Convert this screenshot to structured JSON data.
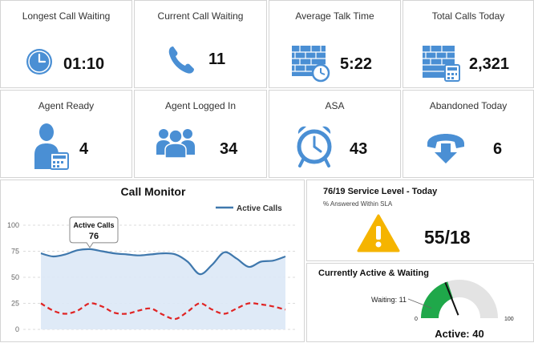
{
  "colors": {
    "accent_blue": "#4a8fd4",
    "warning_yellow": "#f5b400",
    "danger_red": "#e02424",
    "gauge_green": "#1fa84a",
    "line_blue": "#3f78ad"
  },
  "tiles": [
    {
      "title": "Longest Call Waiting",
      "value": "01:10",
      "icon": "clock-icon"
    },
    {
      "title": "Current Call Waiting",
      "value": "11",
      "icon": "phone-icon"
    },
    {
      "title": "Average Talk Time",
      "value": "5:22",
      "icon": "brick-wall-clock-icon"
    },
    {
      "title": "Total Calls Today",
      "value": "2,321",
      "icon": "building-phone-icon"
    },
    {
      "title": "Agent Ready",
      "value": "4",
      "icon": "agent-icon"
    },
    {
      "title": "Agent Logged In",
      "value": "34",
      "icon": "group-icon"
    },
    {
      "title": "ASA",
      "value": "43",
      "icon": "alarm-clock-icon"
    },
    {
      "title": "Abandoned Today",
      "value": "6",
      "icon": "hangup-phone-icon"
    }
  ],
  "call_monitor": {
    "title": "Call Monitor",
    "legend": "Active Calls",
    "tooltip_label": "Active Calls",
    "tooltip_value": "76"
  },
  "service_level": {
    "title": "76/19 Service Level - Today",
    "subtitle": "% Answered Within SLA",
    "value": "55/18",
    "icon": "warning-icon"
  },
  "active_waiting": {
    "title": "Currently Active & Waiting",
    "waiting_label": "Waiting: 11",
    "active_label": "Active: 40",
    "gauge_min": "0",
    "gauge_max": "100",
    "active": 40,
    "waiting": 11
  },
  "chart_data": {
    "type": "line",
    "title": "Call Monitor",
    "xlabel": "",
    "ylabel": "",
    "ylim": [
      0,
      100
    ],
    "yticks": [
      "100",
      "75",
      "50",
      "25",
      "0"
    ],
    "x": [
      0,
      1,
      2,
      3,
      4,
      5,
      6,
      7,
      8,
      9,
      10,
      11,
      12,
      13,
      14,
      15,
      16,
      17,
      18,
      19,
      20
    ],
    "series": [
      {
        "name": "Active Calls",
        "values": [
          73,
          70,
          72,
          76,
          77,
          75,
          73,
          72,
          71,
          72,
          73,
          72,
          65,
          53,
          62,
          74,
          68,
          60,
          65,
          66,
          70
        ],
        "color": "#3f78ad",
        "style": "solid"
      },
      {
        "values": [
          25,
          18,
          15,
          18,
          25,
          22,
          16,
          15,
          18,
          20,
          14,
          10,
          17,
          25,
          19,
          15,
          20,
          25,
          24,
          22,
          19
        ],
        "color": "#e02424",
        "style": "dashed"
      }
    ],
    "annotation": {
      "x": 4,
      "label": "Active Calls",
      "value": "76"
    }
  }
}
